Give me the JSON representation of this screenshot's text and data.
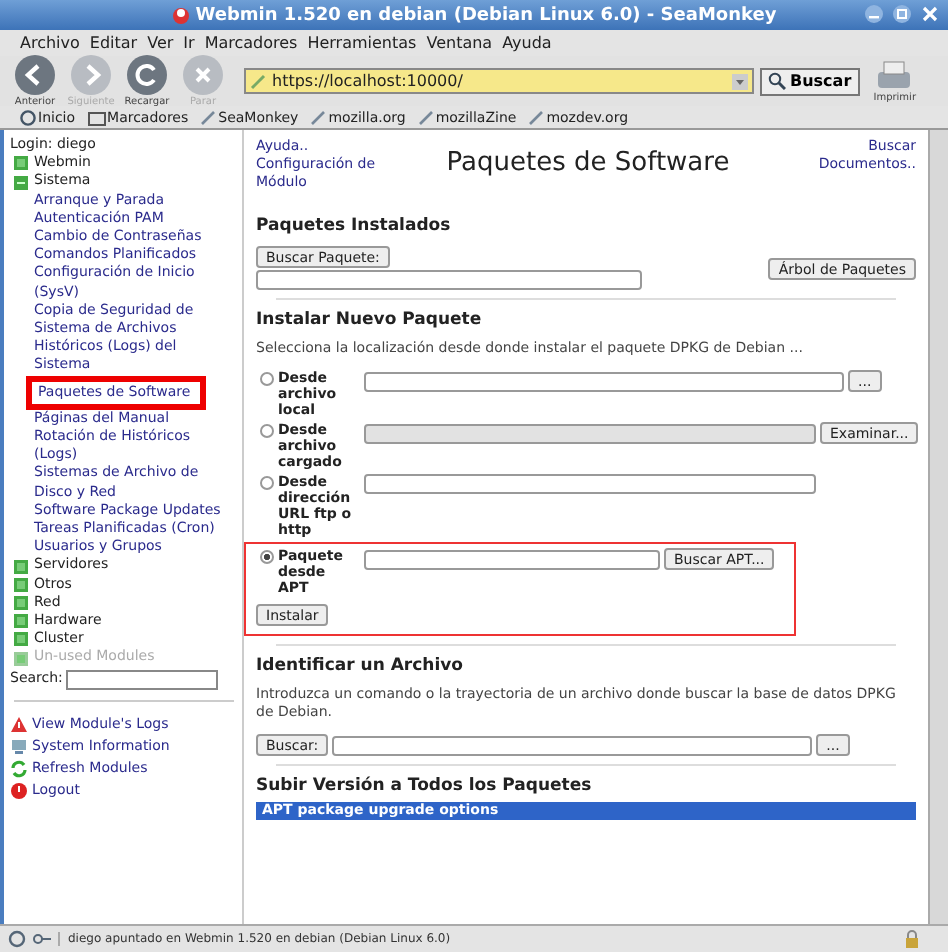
{
  "window": {
    "title": "Webmin 1.520 en debian (Debian Linux 6.0) - SeaMonkey"
  },
  "menu": [
    "Archivo",
    "Editar",
    "Ver",
    "Ir",
    "Marcadores",
    "Herramientas",
    "Ventana",
    "Ayuda"
  ],
  "nav_buttons": [
    {
      "label": "Anterior",
      "disabled": false
    },
    {
      "label": "Siguiente",
      "disabled": true
    },
    {
      "label": "Recargar",
      "disabled": false
    },
    {
      "label": "Parar",
      "disabled": true
    }
  ],
  "address": {
    "value": "https://localhost:10000/"
  },
  "search_button": "Buscar",
  "print_button": "Imprimir",
  "bookmarks": [
    "Inicio",
    "Marcadores",
    "SeaMonkey",
    "mozilla.org",
    "mozillaZine",
    "mozdev.org"
  ],
  "sidebar": {
    "login": "Login: diego",
    "categories": [
      {
        "label": "Webmin",
        "expanded": false,
        "disabled": false
      },
      {
        "label": "Sistema",
        "expanded": true,
        "disabled": false,
        "children": [
          {
            "label": "Arranque y Parada",
            "highlighted": false
          },
          {
            "label": "Autenticación PAM",
            "highlighted": false
          },
          {
            "label": "Cambio de Contraseñas",
            "highlighted": false
          },
          {
            "label": "Comandos Planificados",
            "highlighted": false
          },
          {
            "label": "Configuración de Inicio (SysV)",
            "highlighted": false
          },
          {
            "label": "Copia de Seguridad de Sistema de Archivos",
            "highlighted": false
          },
          {
            "label": "Históricos (Logs) del Sistema",
            "highlighted": false
          },
          {
            "label": "Paquetes de Software",
            "highlighted": true
          },
          {
            "label": "Páginas del Manual",
            "highlighted": false
          },
          {
            "label": "Rotación de Históricos (Logs)",
            "highlighted": false
          },
          {
            "label": "Sistemas de Archivo de Disco y Red",
            "highlighted": false
          },
          {
            "label": "Software Package Updates",
            "highlighted": false
          },
          {
            "label": "Tareas Planificadas (Cron)",
            "highlighted": false
          },
          {
            "label": "Usuarios y Grupos",
            "highlighted": false
          }
        ]
      },
      {
        "label": "Servidores",
        "expanded": false,
        "disabled": false
      },
      {
        "label": "Otros",
        "expanded": false,
        "disabled": false
      },
      {
        "label": "Red",
        "expanded": false,
        "disabled": false
      },
      {
        "label": "Hardware",
        "expanded": false,
        "disabled": false
      },
      {
        "label": "Cluster",
        "expanded": false,
        "disabled": false
      },
      {
        "label": "Un-used Modules",
        "expanded": false,
        "disabled": true
      }
    ],
    "search_label": "Search:",
    "actions": [
      {
        "kind": "logs",
        "label": "View Module's Logs"
      },
      {
        "kind": "info",
        "label": "System Information"
      },
      {
        "kind": "refresh",
        "label": "Refresh Modules"
      },
      {
        "kind": "logout",
        "label": "Logout"
      }
    ]
  },
  "page": {
    "left_links": [
      "Ayuda..",
      "Configuración de Módulo"
    ],
    "title": "Paquetes de Software",
    "right_links": [
      "Buscar Documentos.."
    ],
    "installed": {
      "heading": "Paquetes Instalados",
      "search_button": "Buscar Paquete:",
      "tree_button": "Árbol de Paquetes"
    },
    "install": {
      "heading": "Instalar Nuevo Paquete",
      "description": "Selecciona la localización desde donde instalar el paquete DPKG de Debian ...",
      "options": [
        {
          "kind": "file",
          "label": "Desde archivo local",
          "selected": false,
          "highlighted": false,
          "button": "..."
        },
        {
          "kind": "upload",
          "label": "Desde archivo cargado",
          "selected": false,
          "highlighted": false,
          "button": "Examinar..."
        },
        {
          "kind": "url",
          "label": "Desde dirección URL ftp o http",
          "selected": false,
          "highlighted": false
        },
        {
          "kind": "apt",
          "label": "Paquete desde APT",
          "selected": true,
          "highlighted": true,
          "button": "Buscar APT..."
        }
      ],
      "submit": "Instalar"
    },
    "identify": {
      "heading": "Identificar un Archivo",
      "description": "Introduzca un comando o la trayectoria de un archivo donde buscar la base de datos DPKG de Debian.",
      "search_button": "Buscar:",
      "browse_button": "..."
    },
    "upgrade": {
      "heading": "Subir Versión a Todos los Paquetes",
      "bar": "APT package upgrade options"
    }
  },
  "status_bar": "diego apuntado en Webmin 1.520 en debian (Debian Linux 6.0)"
}
